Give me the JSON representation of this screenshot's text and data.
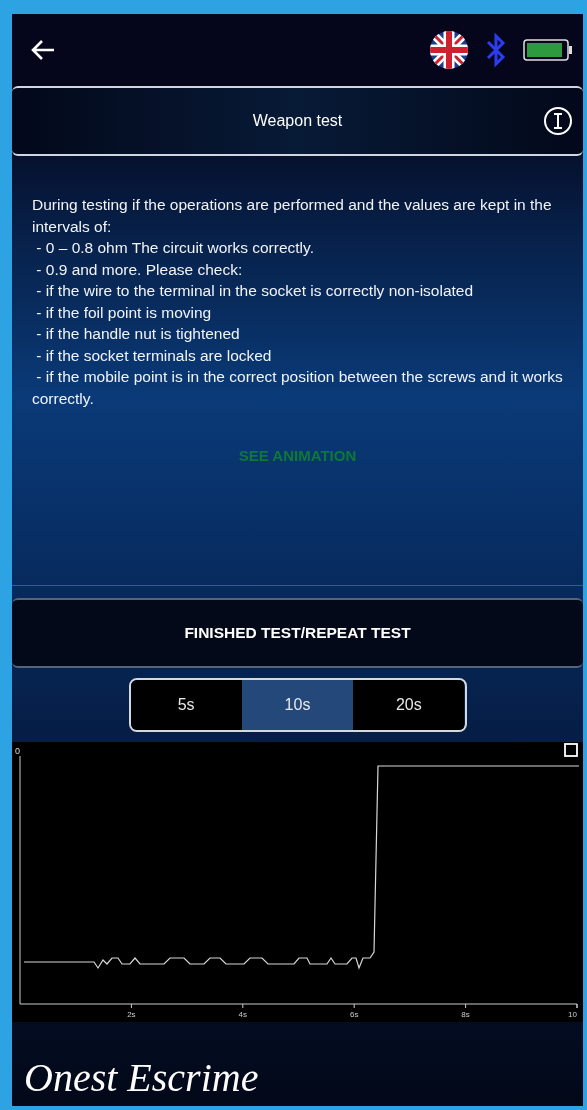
{
  "header": {
    "title": "Weapon test"
  },
  "instructions": [
    "During testing if the operations are performed and the values are kept in the intervals of:",
    " - 0 – 0.8 ohm The circuit works correctly.",
    " - 0.9 and more. Please check:",
    " - if the wire to the terminal in the socket is correctly non-isolated",
    " - if the foil point is moving",
    " - if the handle nut is tightened",
    " - if the socket terminals are locked",
    " - if the mobile point is in the correct position between the screws and it works correctly."
  ],
  "animation_link": "SEE ANIMATION",
  "action_button": "FINISHED TEST/REPEAT TEST",
  "durations": [
    {
      "label": "5s",
      "selected": false
    },
    {
      "label": "10s",
      "selected": true
    },
    {
      "label": "20s",
      "selected": false
    }
  ],
  "graph": {
    "y_tick_label": "0",
    "x_tick_labels": [
      "2s",
      "4s",
      "6s",
      "8s",
      "10"
    ]
  },
  "logo": "Onest Escrime"
}
